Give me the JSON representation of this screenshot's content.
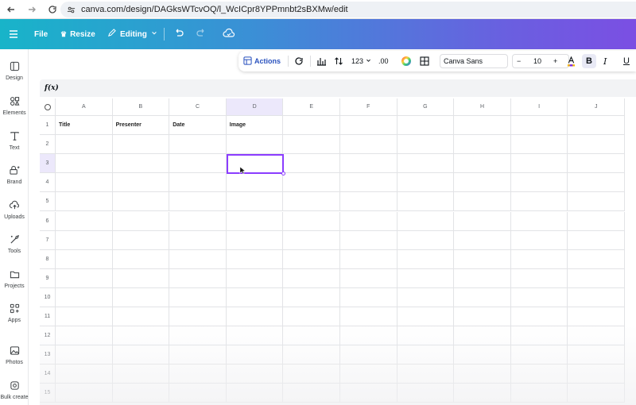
{
  "browser": {
    "url": "canva.com/design/DAGksWTcvOQ/l_WcICpr8YPPmnbt2sBXMw/edit"
  },
  "topbar": {
    "file_label": "File",
    "resize_label": "Resize",
    "editing_label": "Editing",
    "brand_gradient": [
      "#18b4c9",
      "#7b4fe3"
    ]
  },
  "sidebar": {
    "items": [
      {
        "label": "Design",
        "icon": "layout-icon"
      },
      {
        "label": "Elements",
        "icon": "shapes-icon"
      },
      {
        "label": "Text",
        "icon": "text-icon"
      },
      {
        "label": "Brand",
        "icon": "brand-icon"
      },
      {
        "label": "Uploads",
        "icon": "upload-icon"
      },
      {
        "label": "Tools",
        "icon": "tools-icon"
      },
      {
        "label": "Projects",
        "icon": "folder-icon"
      },
      {
        "label": "Apps",
        "icon": "apps-icon"
      },
      {
        "label": "Photos",
        "icon": "photo-icon"
      },
      {
        "label": "Bulk create",
        "icon": "bulk-icon"
      }
    ]
  },
  "toolbar": {
    "actions_label": "Actions",
    "number_format": "123",
    "decimal_label": ".00",
    "font_name": "Canva Sans",
    "font_size": "10",
    "minus": "−",
    "plus": "+",
    "bold": "B",
    "italic": "I",
    "underline": "U",
    "accent_color": "#2a52be"
  },
  "formula": {
    "label": "f(x)"
  },
  "sheet": {
    "columns": [
      "A",
      "B",
      "C",
      "D",
      "E",
      "F",
      "G",
      "H",
      "I",
      "J"
    ],
    "rows": [
      "1",
      "2",
      "3",
      "4",
      "5",
      "6",
      "7",
      "8",
      "9",
      "10",
      "11",
      "12",
      "13",
      "14",
      "15"
    ],
    "header_cells": [
      "Title",
      "Presenter",
      "Date",
      "Image"
    ],
    "selected_cell": "D3",
    "selection_color": "#8b3dff"
  }
}
